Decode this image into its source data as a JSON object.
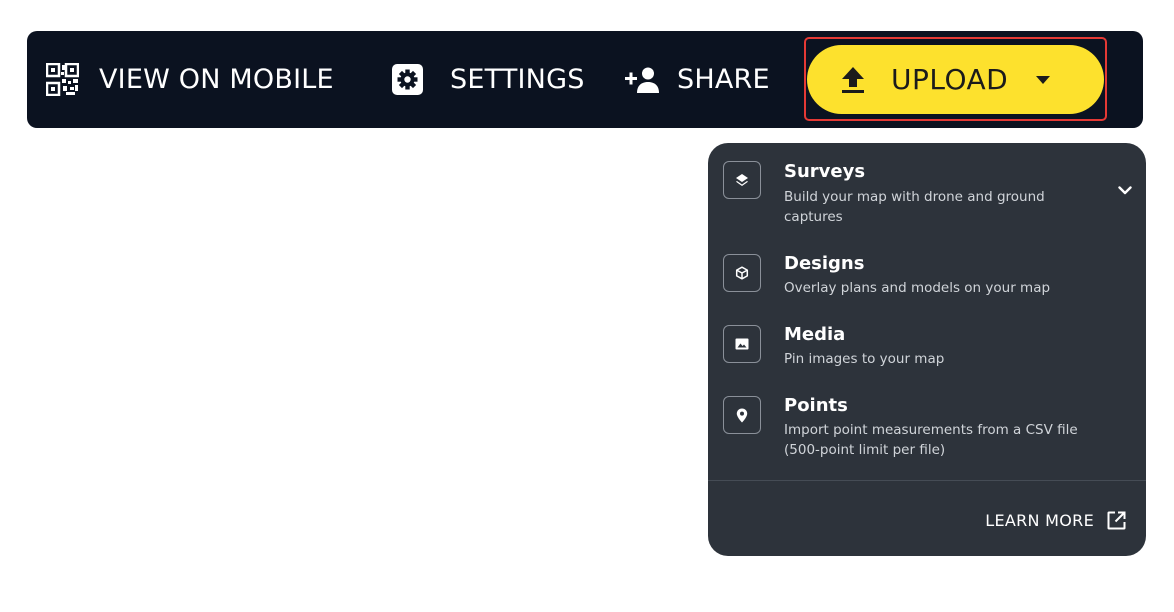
{
  "toolbar": {
    "view_on_mobile": "VIEW ON MOBILE",
    "settings": "SETTINGS",
    "share": "SHARE",
    "upload": "UPLOAD",
    "icons": {
      "view_on_mobile": "qr-code-icon",
      "settings": "gear-icon",
      "share": "add-person-icon",
      "upload": "upload-arrow-icon",
      "dropdown": "caret-down-icon"
    }
  },
  "upload_menu": {
    "items": [
      {
        "title": "Surveys",
        "description": "Build your map with drone and ground captures",
        "icon": "layers-icon",
        "expandable": true
      },
      {
        "title": "Designs",
        "description": "Overlay plans and models on your map",
        "icon": "cube-icon"
      },
      {
        "title": "Media",
        "description": "Pin images to your map",
        "icon": "image-icon"
      },
      {
        "title": "Points",
        "description": "Import point measurements from a CSV file (500-point limit per file)",
        "icon": "map-pin-icon"
      }
    ],
    "learn_more": "LEARN MORE",
    "learn_more_icon": "external-link-icon"
  },
  "colors": {
    "toolbar_bg": "#0b1220",
    "upload_bg": "#fde12d",
    "highlight_outline": "#e53935",
    "menu_bg": "#2d333b"
  }
}
